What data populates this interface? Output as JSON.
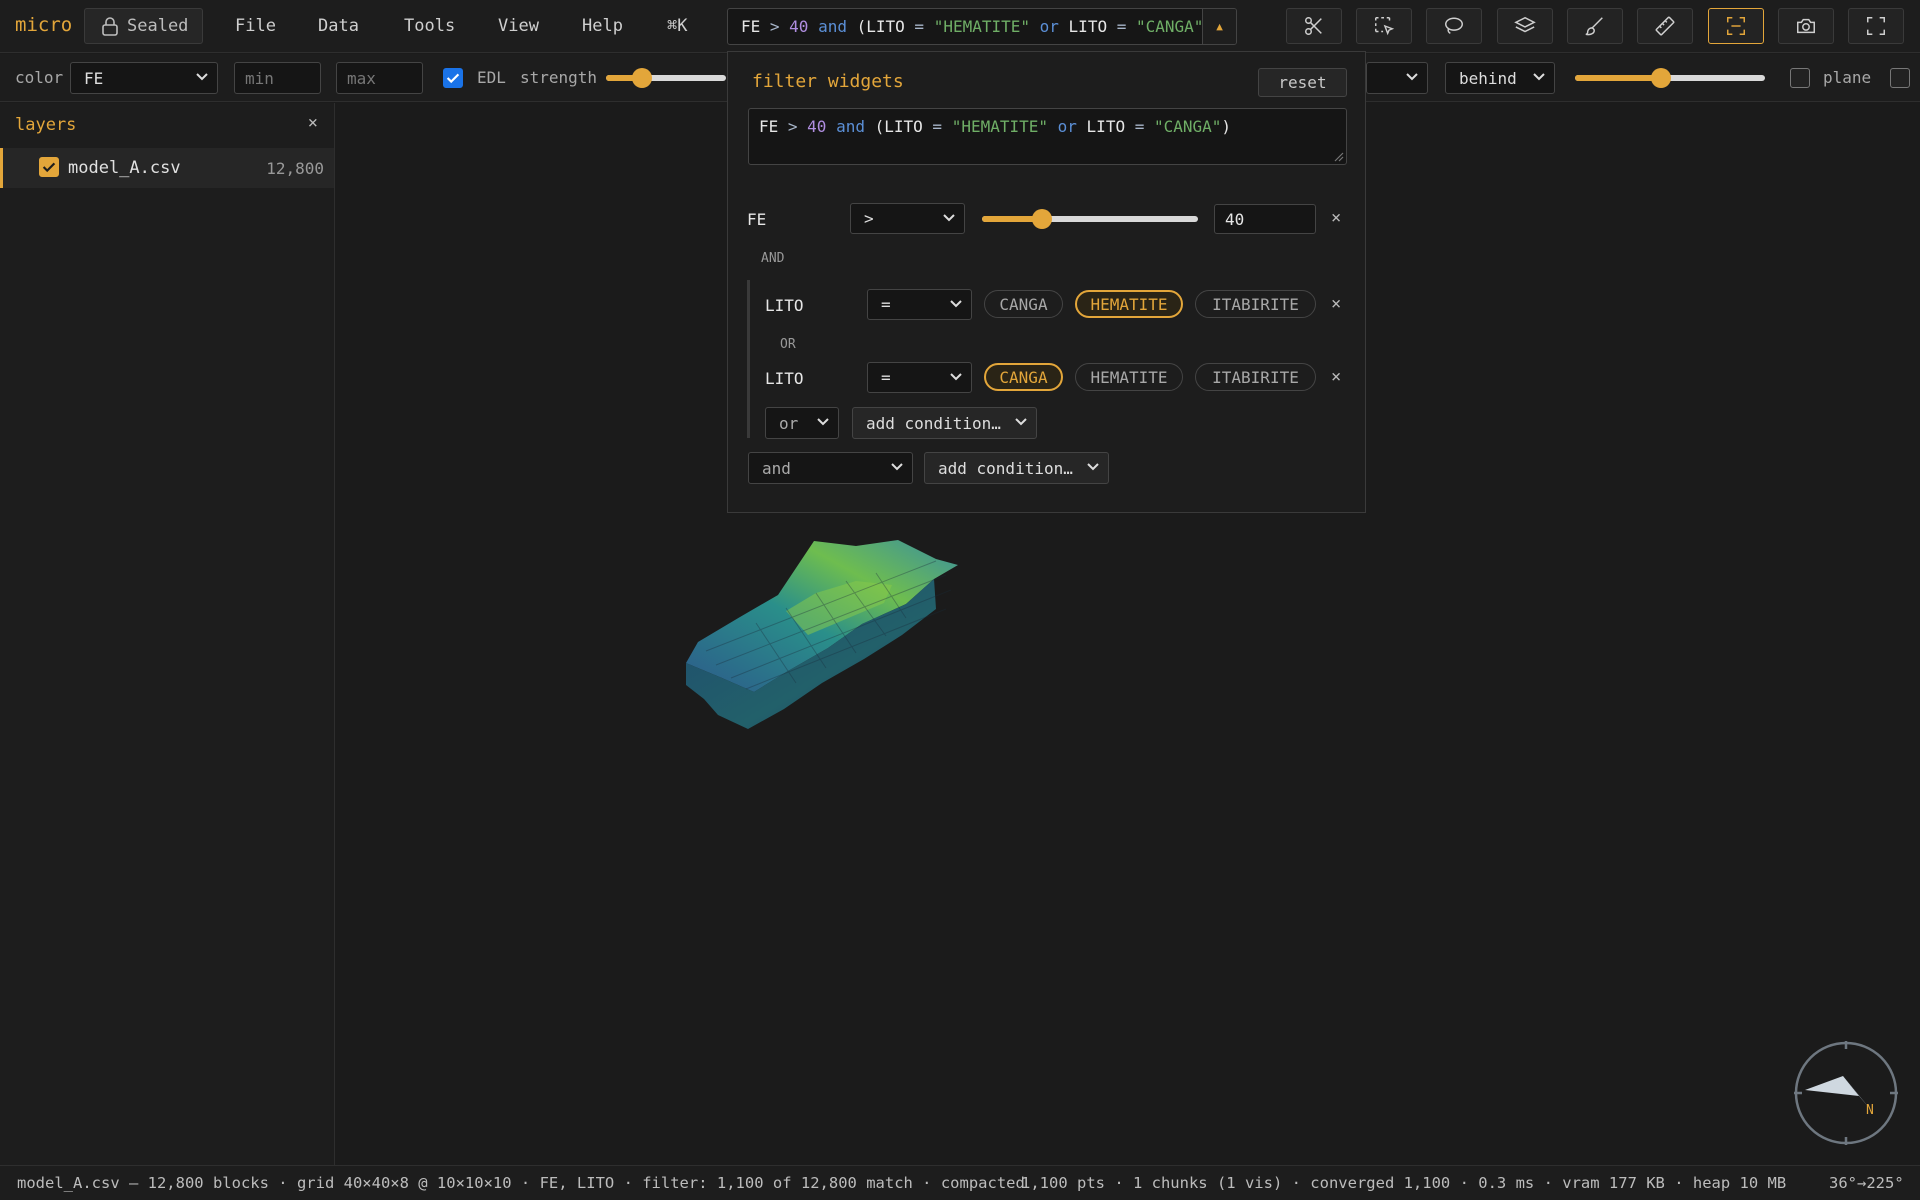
{
  "app": {
    "name": "micro",
    "sealed_label": "Sealed"
  },
  "menu": [
    "File",
    "Data",
    "Tools",
    "View",
    "Help",
    "⌘K"
  ],
  "query": {
    "parts": [
      {
        "t": "FE",
        "c": "fld"
      },
      {
        "t": " > ",
        "c": "opk"
      },
      {
        "t": "40",
        "c": "num"
      },
      {
        "t": " and ",
        "c": "kw"
      },
      {
        "t": "(LITO",
        "c": "fld"
      },
      {
        "t": " = ",
        "c": "opk"
      },
      {
        "t": "\"HEMATITE\"",
        "c": "str"
      },
      {
        "t": " or ",
        "c": "kw"
      },
      {
        "t": "LITO",
        "c": "fld"
      },
      {
        "t": " = ",
        "c": "opk"
      },
      {
        "t": "\"CANGA\"",
        "c": "str"
      },
      {
        "t": ")",
        "c": "fld"
      }
    ]
  },
  "toolbar_icons": [
    "scissors-icon",
    "select-box-icon",
    "lasso-icon",
    "layers-icon",
    "brush-icon",
    "ruler-icon",
    "focus-frame-icon",
    "camera-icon",
    "fullscreen-icon"
  ],
  "options": {
    "color_label": "color",
    "color_value": "FE",
    "min_placeholder": "min",
    "max_placeholder": "max",
    "edl_label": "EDL",
    "strength_label": "strength",
    "strength_value": 0.3,
    "behind_value": "behind",
    "opacity_value": 0.45,
    "plane_label": "plane"
  },
  "sidebar": {
    "title": "layers",
    "close": "×",
    "layers": [
      {
        "name": "model_A.csv",
        "count": "12,800"
      }
    ]
  },
  "filter": {
    "title": "filter widgets",
    "reset": "reset",
    "and_label": "AND",
    "or_label": "OR",
    "fe": {
      "field": "FE",
      "op": ">",
      "value": "40",
      "slider": 0.28
    },
    "lito1": {
      "field": "LITO",
      "op": "=",
      "options": [
        {
          "label": "CANGA",
          "on": false
        },
        {
          "label": "HEMATITE",
          "on": true
        },
        {
          "label": "ITABIRITE",
          "on": false
        }
      ]
    },
    "lito2": {
      "field": "LITO",
      "op": "=",
      "options": [
        {
          "label": "CANGA",
          "on": true
        },
        {
          "label": "HEMATITE",
          "on": false
        },
        {
          "label": "ITABIRITE",
          "on": false
        }
      ]
    },
    "inner_join": "or",
    "outer_join": "and",
    "add_condition": "add condition…",
    "remove": "×"
  },
  "compass": {
    "label": "N"
  },
  "status": {
    "left": "model_A.csv — 12,800 blocks · grid 40×40×8 @ 10×10×10 · FE, LITO · filter: 1,100 of 12,800 match · compacted",
    "mid": "1,100 pts · 1 chunks (1 vis) · converged 1,100 · 0.3 ms · vram 177 KB · heap 10 MB",
    "right": "36°→225°"
  }
}
